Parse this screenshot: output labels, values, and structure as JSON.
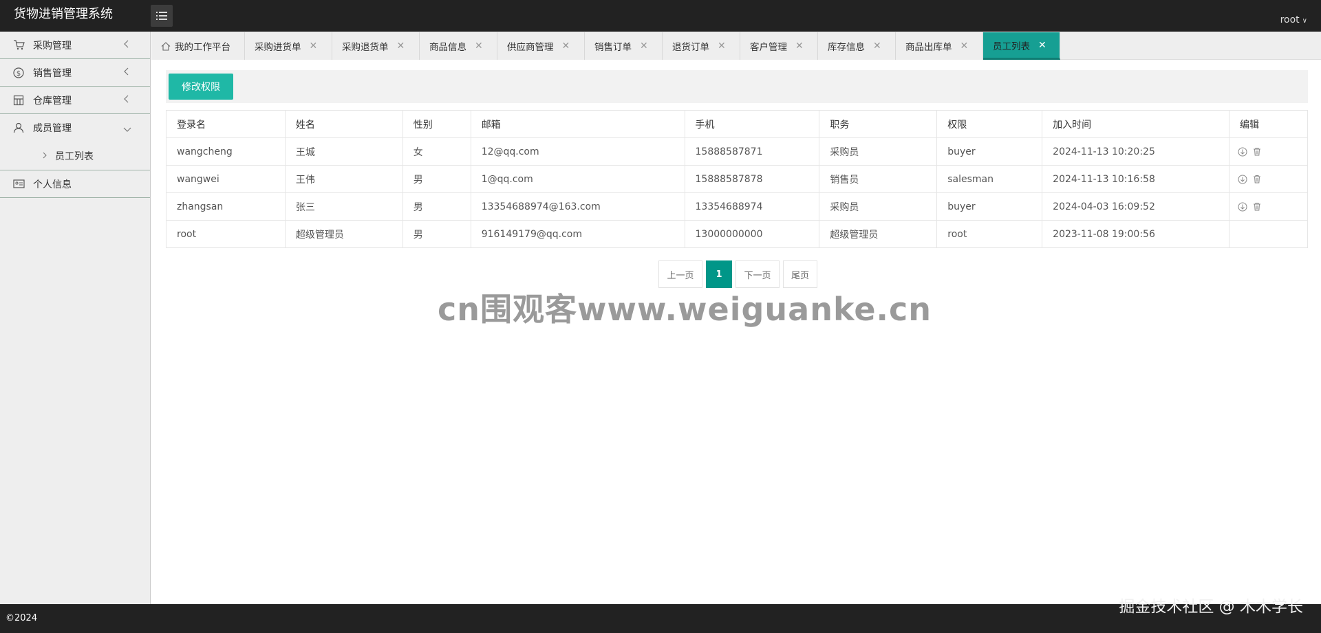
{
  "app": {
    "title": "货物进销管理系统",
    "user": "root"
  },
  "sidebar": {
    "groups": [
      {
        "label": "采购管理",
        "icon": "cart-icon"
      },
      {
        "label": "销售管理",
        "icon": "dollar-icon"
      },
      {
        "label": "仓库管理",
        "icon": "warehouse-icon"
      },
      {
        "label": "成员管理",
        "icon": "user-icon"
      }
    ],
    "sub": {
      "label": "员工列表"
    },
    "personal": {
      "label": "个人信息",
      "icon": "id-card-icon"
    }
  },
  "tabs": [
    {
      "label": "我的工作平台"
    },
    {
      "label": "采购进货单"
    },
    {
      "label": "采购退货单"
    },
    {
      "label": "商品信息"
    },
    {
      "label": "供应商管理"
    },
    {
      "label": "销售订单"
    },
    {
      "label": "退货订单"
    },
    {
      "label": "客户管理"
    },
    {
      "label": "库存信息"
    },
    {
      "label": "商品出库单"
    },
    {
      "label": "员工列表"
    }
  ],
  "toolbar": {
    "edit_permission": "修改权限"
  },
  "table": {
    "headers": [
      "登录名",
      "姓名",
      "性别",
      "邮箱",
      "手机",
      "职务",
      "权限",
      "加入时间",
      "编辑"
    ],
    "rows": [
      [
        "wangcheng",
        "王城",
        "女",
        "12@qq.com",
        "15888587871",
        "采购员",
        "buyer",
        "2024-11-13 10:20:25"
      ],
      [
        "wangwei",
        "王伟",
        "男",
        "1@qq.com",
        "15888587878",
        "销售员",
        "salesman",
        "2024-11-13 10:16:58"
      ],
      [
        "zhangsan",
        "张三",
        "男",
        "13354688974@163.com",
        "13354688974",
        "采购员",
        "buyer",
        "2024-04-03 16:09:52"
      ],
      [
        "root",
        "超级管理员",
        "男",
        "916149179@qq.com",
        "13000000000",
        "超级管理员",
        "root",
        "2023-11-08 19:00:56"
      ]
    ]
  },
  "pager": {
    "prev": "上一页",
    "current": "1",
    "next": "下一页",
    "last": "尾页"
  },
  "watermark": "cn围观客www.weiguanke.cn",
  "footer": {
    "copyright": "©2024",
    "credit": "掘金技术社区 @ 木木学长"
  },
  "colors": {
    "header": "#222222",
    "accent": "#009688",
    "button": "#1fb8a6",
    "sidebar": "#eeeeee"
  }
}
